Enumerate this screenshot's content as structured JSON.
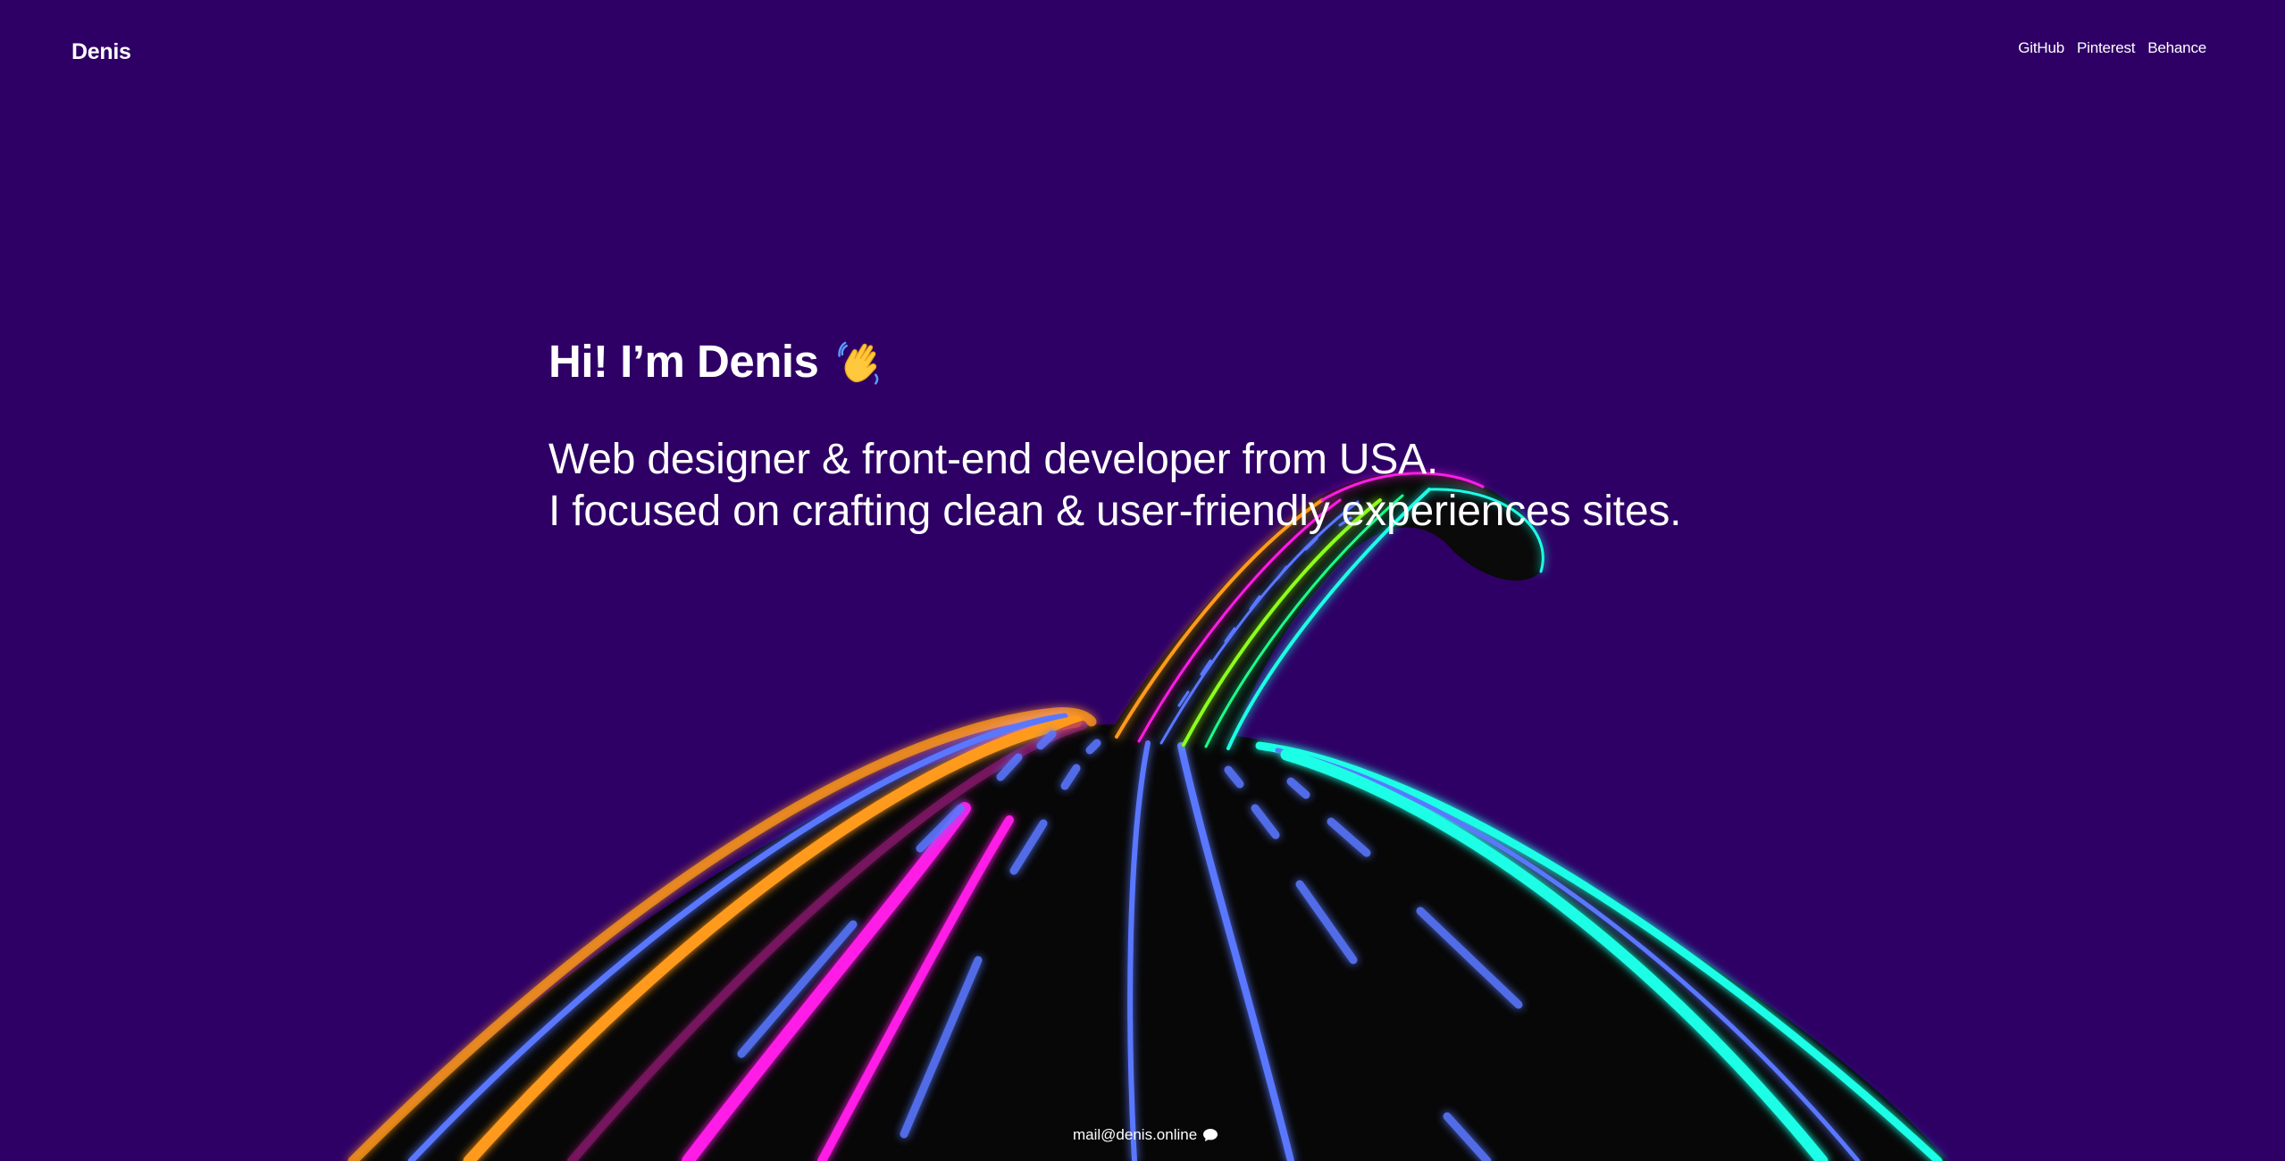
{
  "header": {
    "logo": "Denis",
    "nav": [
      {
        "label": "GitHub"
      },
      {
        "label": "Pinterest"
      },
      {
        "label": "Behance"
      }
    ]
  },
  "hero": {
    "title": "Hi! I’m Denis",
    "title_icon": "waving-hand-icon",
    "lines": [
      "Web designer & front-end developer from USA.",
      "I focused on crafting clean & user-friendly experiences sites."
    ]
  },
  "footer": {
    "email": "mail@denis.online",
    "email_icon": "speech-bubble-icon"
  },
  "colors": {
    "background": "#2e0066",
    "text": "#ffffff",
    "road": "#080808",
    "neon_orange": "#ff9a1a",
    "neon_magenta": "#ff1ae6",
    "neon_blue": "#5a78ff",
    "neon_cyan": "#1affe6"
  }
}
